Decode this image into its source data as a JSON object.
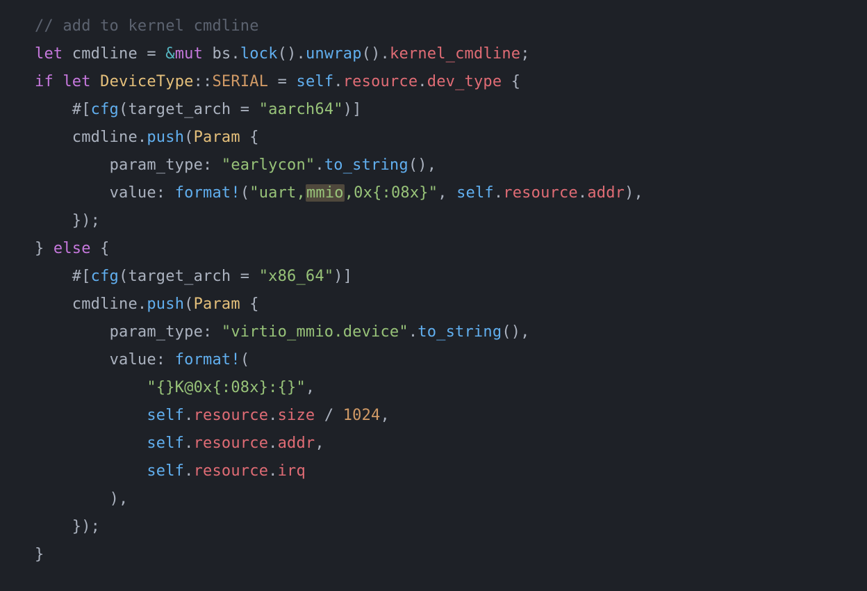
{
  "code": {
    "comment": "// add to kernel cmdline",
    "l2_let": "let",
    "l2_cmdline": "cmdline",
    "l2_eq": " = ",
    "l2_amp": "&",
    "l2_mut": "mut",
    "l2_bs": " bs",
    "l2_lock": "lock",
    "l2_unwrap": "unwrap",
    "l2_kernel": "kernel_cmdline",
    "l3_if": "if",
    "l3_let": "let",
    "l3_DeviceType": "DeviceType",
    "l3_cc": "::",
    "l3_SERIAL": "SERIAL",
    "l3_eq": " = ",
    "l3_self": "self",
    "l3_resource": "resource",
    "l3_devtype": "dev_type",
    "l4_attr_open": "#[",
    "l4_cfg": "cfg",
    "l4_target": "target_arch = ",
    "l4_aarch": "\"aarch64\"",
    "l4_close": ")]",
    "l5_cmdline": "cmdline",
    "l5_push": "push",
    "l5_Param": "Param",
    "l6_paramtype": "param_type",
    "l6_earlycon": "\"earlycon\"",
    "l6_tostring": "to_string",
    "l7_value": "value",
    "l7_format": "format!",
    "l7_str_a": "\"uart,",
    "l7_str_hl": "mmio",
    "l7_str_b": ",0x{:08x}\"",
    "l7_self": "self",
    "l7_resource": "resource",
    "l7_addr": "addr",
    "l8_close": "});",
    "l9_else": "else",
    "l10_attr_open": "#[",
    "l10_cfg": "cfg",
    "l10_target": "target_arch = ",
    "l10_x86": "\"x86_64\"",
    "l10_close": ")]",
    "l11_cmdline": "cmdline",
    "l11_push": "push",
    "l11_Param": "Param",
    "l12_paramtype": "param_type",
    "l12_virtio": "\"virtio_mmio.device\"",
    "l12_tostring": "to_string",
    "l13_value": "value",
    "l13_format": "format!",
    "l14_fmtstr": "\"{}K@0x{:08x}:{}\"",
    "l15_self": "self",
    "l15_resource": "resource",
    "l15_size": "size",
    "l15_div": " / ",
    "l15_1024": "1024",
    "l16_self": "self",
    "l16_resource": "resource",
    "l16_addr": "addr",
    "l17_self": "self",
    "l17_resource": "resource",
    "l17_irq": "irq",
    "l18_close": "),",
    "l19_close": "});",
    "l20_close": "}"
  }
}
